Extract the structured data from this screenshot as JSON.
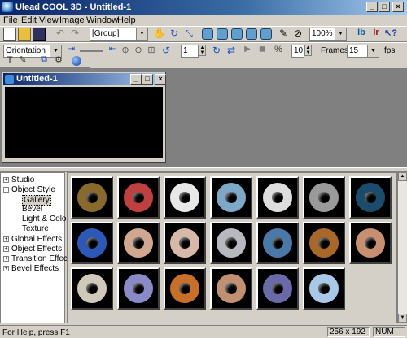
{
  "window": {
    "title": "Ulead COOL 3D - Untitled-1"
  },
  "menu": [
    "File",
    "Edit",
    "View",
    "Image",
    "Window",
    "Help"
  ],
  "toolbar": {
    "group_combo": "[Group]",
    "zoom_combo": "100%",
    "orientation_combo": "Orientation",
    "frame_value": "1",
    "frames_value": "10",
    "frames_label": "Frames",
    "fps_value": "15",
    "fps_label": "fps"
  },
  "document": {
    "title": "Untitled-1"
  },
  "tree": [
    {
      "label": "Studio",
      "expander": "+"
    },
    {
      "label": "Object Style",
      "expander": "−"
    },
    {
      "label": "Gallery",
      "selected": true
    },
    {
      "label": "Bevel"
    },
    {
      "label": "Light & Color"
    },
    {
      "label": "Texture"
    },
    {
      "label": "Global Effects",
      "expander": "+"
    },
    {
      "label": "Object Effects",
      "expander": "+"
    },
    {
      "label": "Transition Effects",
      "expander": "+"
    },
    {
      "label": "Bevel Effects",
      "expander": "+"
    }
  ],
  "gallery": {
    "thumb_colors": [
      "#8a6a2a",
      "#c04040",
      "#e8e8e8",
      "#7ea8c8",
      "#dedede",
      "#9a9a9a",
      "#1a4c6e",
      "#2c58b8",
      "#d0a890",
      "#d8b8a8",
      "#b8b8c0",
      "#4a78a8",
      "#a86828",
      "#c89070",
      "#d0c8b8",
      "#8a8ac8",
      "#c87028",
      "#c09070",
      "#6a6aa8",
      "#a8c8e8"
    ]
  },
  "status": {
    "help": "For Help, press F1",
    "size": "256 x 192",
    "num": "NUM"
  }
}
